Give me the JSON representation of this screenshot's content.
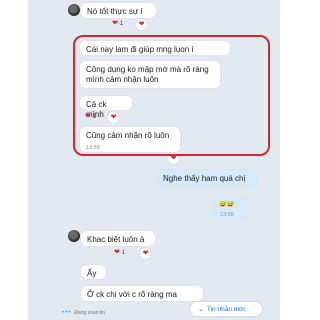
{
  "messages": [
    {
      "text": "Nó tốt thực sự í",
      "reactions": "1"
    },
    {
      "text": "Cái nay lam đi giúp mng luon í"
    },
    {
      "text": "Công dụng ko mập mờ mà rõ ràng mình cảm nhận luôn"
    },
    {
      "text": "Cả ck mình",
      "reactions": "1"
    },
    {
      "text": "Cũng cảm nhận rõ luôn",
      "time": "13:58"
    },
    {
      "text": "Nghe thấy ham quá chị"
    },
    {
      "text": "😅😅",
      "time": "13:58"
    },
    {
      "text": "Khac biệt luôn ả",
      "reactions": "1"
    },
    {
      "text": "Ấy"
    },
    {
      "text": "Ở ck chị với c rõ ràng ma"
    }
  ],
  "new_messages_button": "Tin nhắn mới",
  "typing_status": "Đang soạn tin",
  "colors": {
    "highlight": "#d3262e",
    "my_bubble": "#d5ebfd",
    "chat_bg": "#e2e9f1"
  }
}
